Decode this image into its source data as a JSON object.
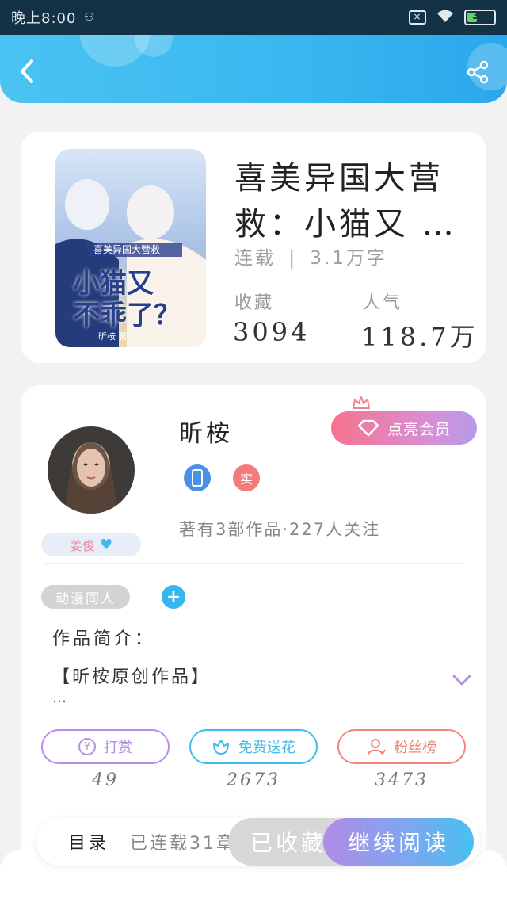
{
  "status_bar": {
    "time": "晚上8:00",
    "battery": "37"
  },
  "book": {
    "title": "喜美异国大营救：小猫又…",
    "title_line1": "喜美异国大营",
    "title_line2": "救：小猫又 …",
    "cover": {
      "series": "喜美异国大营救",
      "main_title_1": "小猫又",
      "main_title_2": "不乖了？",
      "author_line": "昕桉 著"
    },
    "status": "连载",
    "word_count": "3.1万字",
    "collect_label": "收藏",
    "collect_value": "3094",
    "popularity_label": "人气",
    "popularity_value": "118.7万"
  },
  "author": {
    "name": "昕桉",
    "badge": "姜俊",
    "vip_button": "点亮会员",
    "real_badge": "实",
    "stats": "著有3部作品·227人关注"
  },
  "tags": {
    "items": [
      "动漫同人"
    ],
    "add": "+"
  },
  "intro": {
    "label": "作品简介：",
    "text": "【昕桉原创作品】",
    "more": "…"
  },
  "actions": [
    {
      "label": "打赏",
      "count": "49",
      "color": "#b48fe3"
    },
    {
      "label": "免费送花",
      "count": "2673",
      "color": "#3fbcec"
    },
    {
      "label": "粉丝榜",
      "count": "3473",
      "color": "#f0857f"
    }
  ],
  "bottom": {
    "toc": "目录",
    "toc_status": "已连载31章",
    "collected": "已收藏",
    "read": "继续阅读"
  },
  "colors": {
    "header": "#39b8f0",
    "status_bar": "#143246",
    "vip_gradient_start": "#f7738d",
    "vip_gradient_end": "#b79ae6"
  }
}
